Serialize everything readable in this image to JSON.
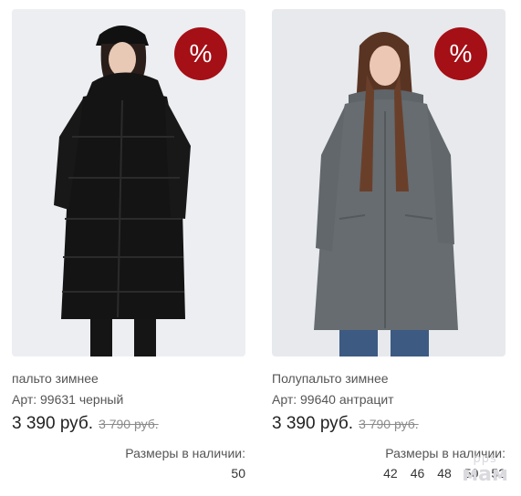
{
  "products": [
    {
      "badge": "%",
      "name": "пальто зимнее",
      "sku": "Арт: 99631 черный",
      "price": "3 390 руб.",
      "old_price": "3 790 руб.",
      "sizes_label": "Размеры в наличии:",
      "sizes": [
        "50"
      ],
      "image_colors": {
        "background": "#eceef1",
        "coat": "#141414",
        "skin": "#e8c9b5",
        "hair": "#2a1e1a"
      }
    },
    {
      "badge": "%",
      "name": "Полупальто зимнее",
      "sku": "Арт: 99640 антрацит",
      "price": "3 390 руб.",
      "old_price": "3 790 руб.",
      "sizes_label": "Размеры в наличии:",
      "sizes": [
        "42",
        "46",
        "48",
        "50",
        "52"
      ],
      "image_colors": {
        "background": "#e7e9ec",
        "coat": "#666c70",
        "skin": "#ecc8b4",
        "hair": "#5a3423",
        "jeans": "#3d5a82"
      }
    }
  ],
  "watermark": {
    "small": "pps",
    "big": "мам"
  },
  "colors": {
    "badge": "#a50f16",
    "price": "#222222",
    "muted": "#8a8a8a"
  }
}
